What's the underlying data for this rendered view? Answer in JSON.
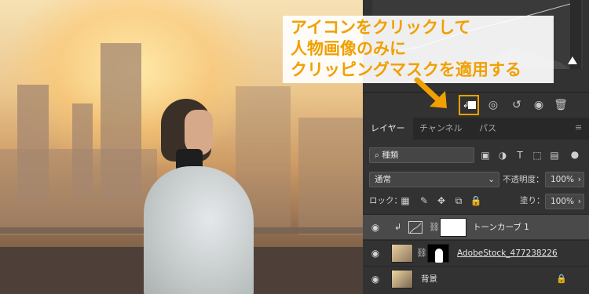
{
  "annotation": {
    "line1": "アイコンをクリックして",
    "line2": "人物画像のみに",
    "line3": "クリッピングマスクを適用する",
    "color": "#f0a000"
  },
  "properties_toolbar": {
    "buttons": [
      "clip-to-layer",
      "view-previous-state",
      "reset",
      "visibility",
      "delete"
    ]
  },
  "layers_panel": {
    "tabs": [
      {
        "label": "レイヤー",
        "active": true
      },
      {
        "label": "チャンネル",
        "active": false
      },
      {
        "label": "パス",
        "active": false
      }
    ],
    "filter": {
      "label": "種類"
    },
    "blend_mode": "通常",
    "opacity_label": "不透明度：",
    "opacity_value": "100%",
    "lock_label": "ロック：",
    "fill_label": "塗り：",
    "fill_value": "100%",
    "layers": [
      {
        "name": "トーンカーブ 1",
        "selected": true,
        "clipped": true
      },
      {
        "name": "AdobeStock_477238226",
        "selected": false,
        "underlined": true
      },
      {
        "name": "背景",
        "selected": false,
        "locked": true
      }
    ]
  }
}
